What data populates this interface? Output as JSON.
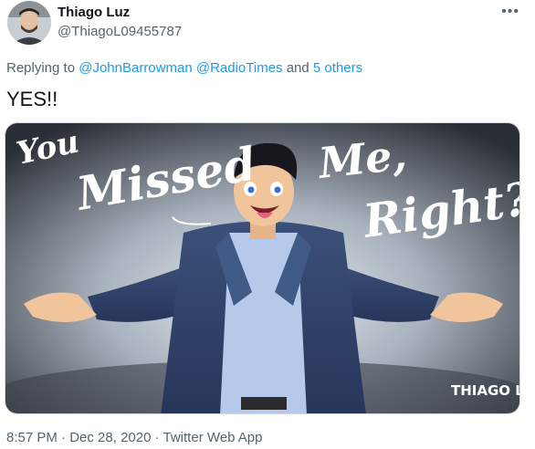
{
  "author": {
    "display_name": "Thiago Luz",
    "handle": "@ThiagoL09455787",
    "avatar_icon": "person-portrait"
  },
  "more_icon": "•••",
  "reply_context": {
    "prefix": "Replying to ",
    "mention_1": "@JohnBarrowman",
    "mention_2": "@RadioTimes",
    "and": " and ",
    "others": "5 others"
  },
  "tweet_text": "YES!!",
  "media": {
    "text_you": "You",
    "text_missed": "Missed",
    "text_me": "Me,",
    "text_right": "Right?",
    "signature": "THIAGO LUZ"
  },
  "meta": {
    "time": "8:57 PM",
    "sep1": " · ",
    "date": "Dec 28, 2020",
    "sep2": " · ",
    "client": "Twitter Web App"
  },
  "colors": {
    "link": "#1d9bf0",
    "secondary": "#536471",
    "coat": "#33466e",
    "shirt": "#b6c9ea",
    "background_dark": "#2b2f37",
    "background_light": "#dde3ea"
  }
}
